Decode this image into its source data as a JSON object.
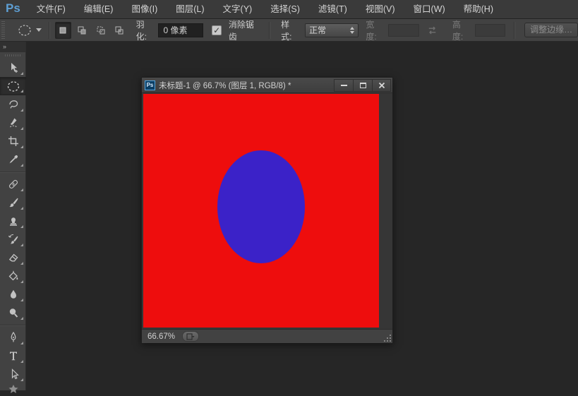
{
  "app": {
    "logo": "Ps",
    "background_color": "#262626",
    "panel_color": "#424242",
    "menubar_color": "#3a3a3a",
    "text_color": "#d4d4d4"
  },
  "menu_bar": {
    "items": [
      "文件(F)",
      "编辑(E)",
      "图像(I)",
      "图层(L)",
      "文字(Y)",
      "选择(S)",
      "滤镜(T)",
      "视图(V)",
      "窗口(W)",
      "帮助(H)"
    ]
  },
  "options_bar": {
    "tool_preset_icon": "elliptical-marquee-icon",
    "selection_modes": [
      "new-selection",
      "add-to-selection",
      "subtract-from-selection",
      "intersect-selection"
    ],
    "active_selection_mode": "new-selection",
    "feather_label": "羽化:",
    "feather_value": "0 像素",
    "antialias_checked": true,
    "antialias_check_glyph": "✓",
    "antialias_label": "消除锯齿",
    "style_label": "样式:",
    "style_value": "正常",
    "width_label": "宽度:",
    "width_value": "",
    "swap_icon": "swap-dimensions-icon",
    "height_label": "高度:",
    "height_value": "",
    "refine_edge_label": "调整边缘…",
    "refine_edge_enabled": false
  },
  "toolbar": {
    "collapse_glyph": "»",
    "tools": [
      "move",
      "elliptical-marquee",
      "lasso",
      "quick-selection",
      "crop",
      "eyedropper",
      "spot-healing-brush",
      "brush",
      "clone-stamp",
      "history-brush",
      "eraser",
      "paint-bucket",
      "blur",
      "dodge",
      "pen",
      "type",
      "path-selection",
      "shape"
    ],
    "selected_tool": "elliptical-marquee"
  },
  "document_window": {
    "title": "未标题-1 @ 66.7% (图层 1, RGB/8) *",
    "window_icon": "ps-document-icon",
    "window_controls": [
      "minimize-icon",
      "maximize-icon",
      "close-icon"
    ],
    "close_glyph": "✕",
    "zoom_level": "66.67%",
    "status_icon": "document-info-icon",
    "canvas": {
      "background_color": "#ee0d0d",
      "ellipse_color": "#3b22c8",
      "zoom_percent": 66.67
    }
  }
}
